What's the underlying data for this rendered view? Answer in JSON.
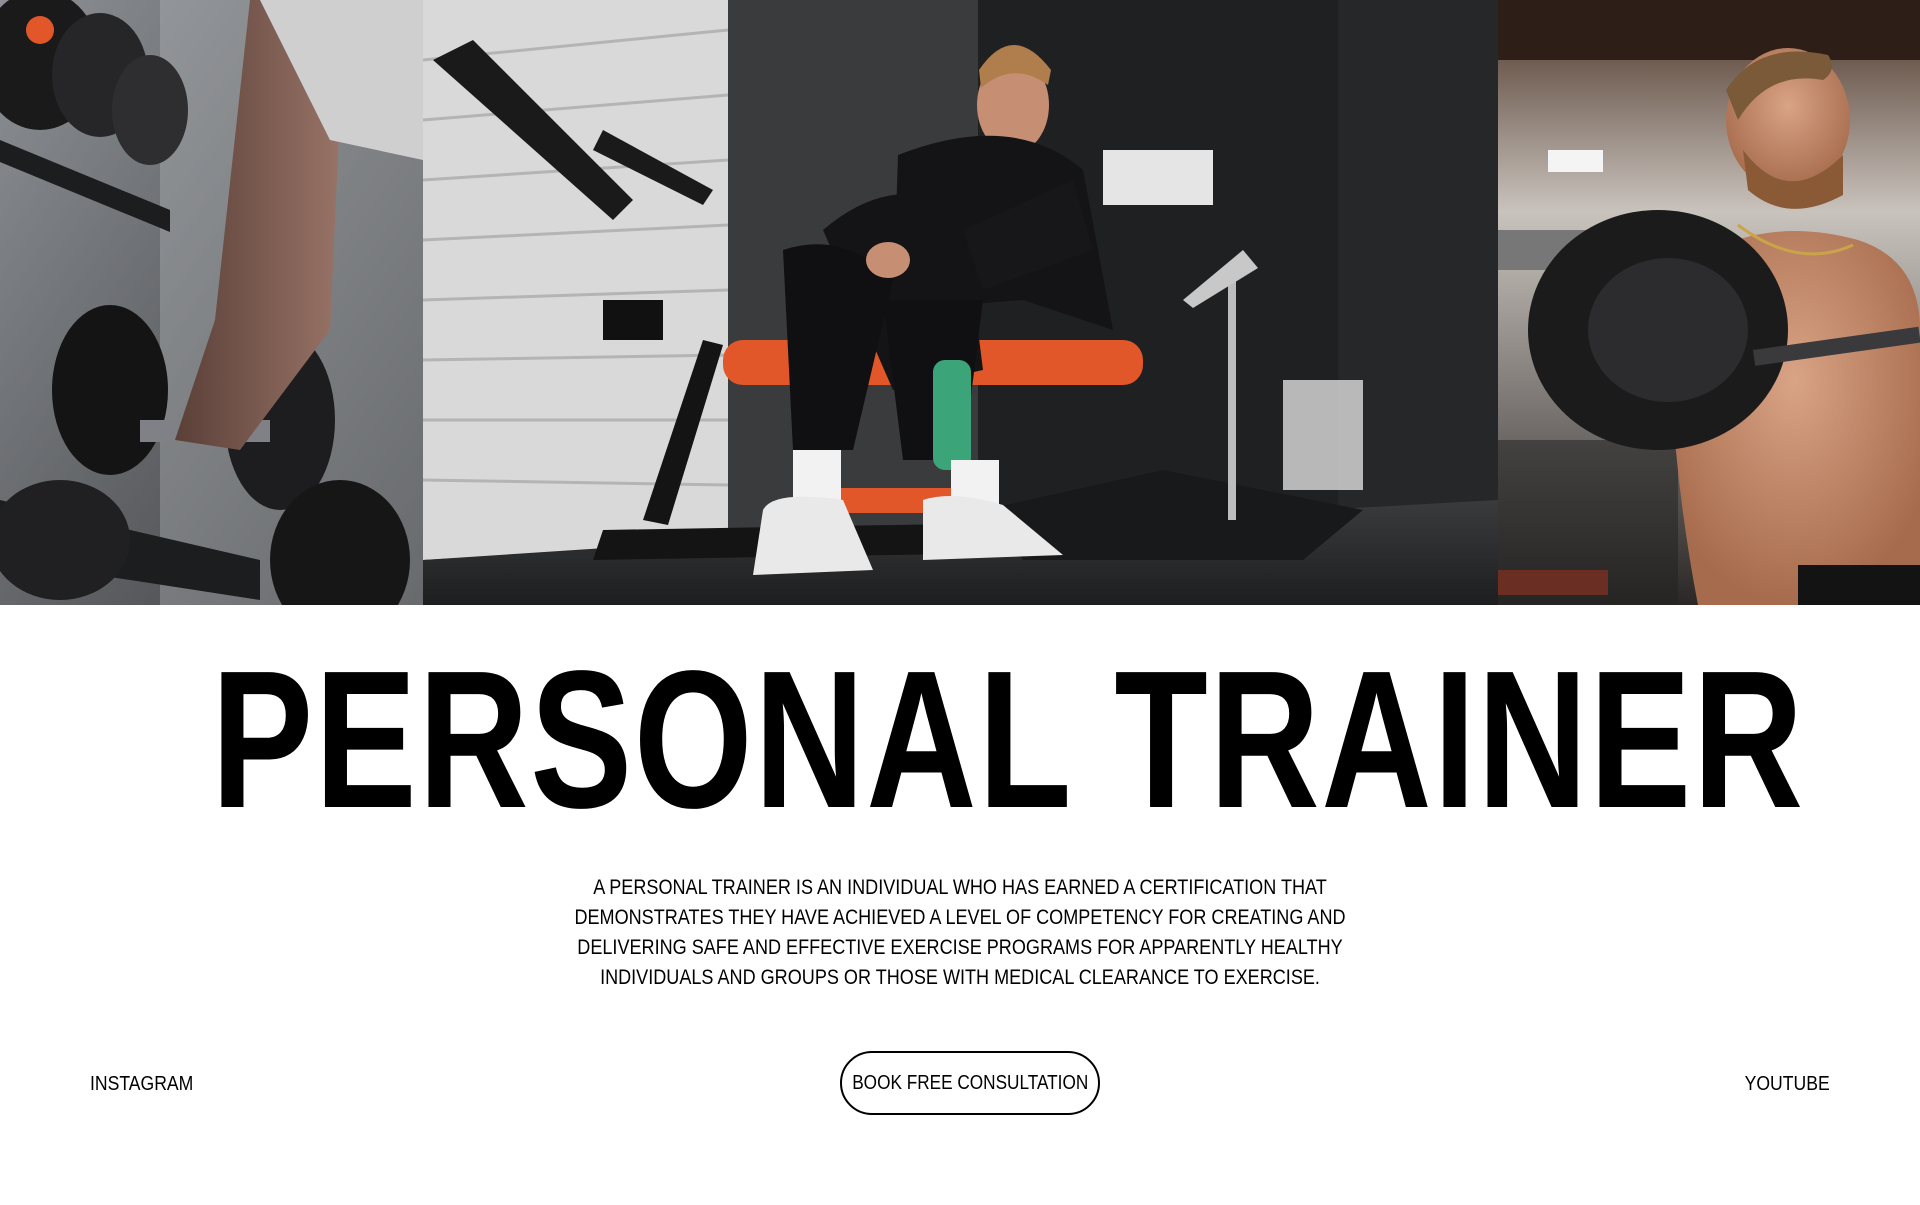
{
  "hero": {
    "left_image": "dumbbell-rack-photo",
    "center_image": "trainer-seated-on-bench-photo",
    "right_image": "athlete-barbell-press-photo",
    "accent_color": "#e2572a"
  },
  "headline": "PERSONAL TRAINER",
  "description": "A personal trainer is an individual who has earned a certification that demonstrates they have achieved a level of competency for creating and delivering safe and effective exercise programs for apparently healthy individuals and groups or those with medical clearance to exercise.",
  "footer": {
    "instagram_label": "INSTAGRAM",
    "cta_label": "BOOK FREE CONSULTATION",
    "youtube_label": "YOUTUBE"
  }
}
